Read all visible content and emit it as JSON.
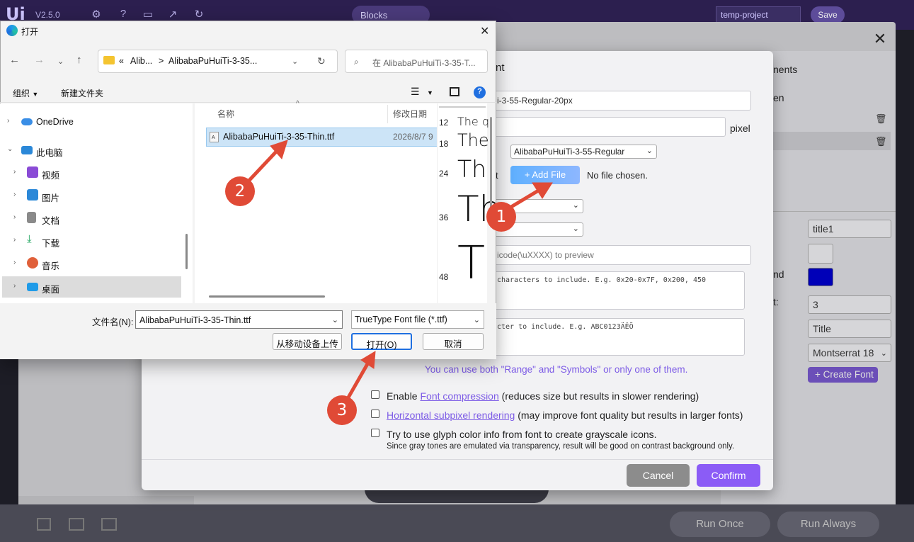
{
  "app": {
    "logo": "Ui",
    "version": "V2.5.0",
    "blocks_tab": "Blocks",
    "project_name": "temp-project",
    "save_label": "Save",
    "run_once": "Run Once",
    "run_always": "Run Always"
  },
  "right_panel": {
    "components_label": "nents",
    "screen_label": "en",
    "name_value": "title1",
    "and_label": "nd",
    "t_label": "t:",
    "spacing_value": "3",
    "text_value": "Title",
    "font_value": "Montserrat 18",
    "create_font": "Create Font"
  },
  "font_dialog": {
    "title_suffix": "nt",
    "name_value": "i-3-55-Regular-20px",
    "size_unit": "pixel",
    "font_select": "AlibabaPuHuiTi-3-55-Regular",
    "font_label_suffix": "t",
    "add_file": "Add File",
    "no_file": "No file chosen.",
    "preview_placeholder": "icode(\\uXXXX) to preview",
    "range_placeholder": "characters to include. E.g. 0x20-0x7F, 0x200, 450",
    "symbols_placeholder": "cter to include. E.g. ABC0123ÄÊÕ",
    "hint": "You can use both \"Range\" and \"Symbols\" or only one of them.",
    "opt1_prefix": "Enable ",
    "opt1_link": "Font compression",
    "opt1_suffix": " (reduces size but results in slower rendering)",
    "opt2_link": "Horizontal subpixel rendering",
    "opt2_suffix": " (may improve font quality but results in larger fonts)",
    "opt3_text": "Try to use glyph color info from font to create grayscale icons.",
    "opt3_sub": "Since gray tones are emulated via transparency, result will be good on contrast background only.",
    "cancel": "Cancel",
    "confirm": "Confirm"
  },
  "open_dialog": {
    "title": "打开",
    "address": {
      "prefix": "«",
      "crumb1": "Alib...",
      "sep": ">",
      "crumb2": "AlibabaPuHuiTi-3-35..."
    },
    "search_placeholder": "在 AlibabaPuHuiTi-3-35-T...",
    "commands": {
      "organize": "组织",
      "new_folder": "新建文件夹"
    },
    "nav": [
      {
        "label": "OneDrive",
        "icon": "cloud-icon"
      },
      {
        "label": "此电脑",
        "icon": "computer-icon"
      },
      {
        "label": "视频",
        "icon": "video-icon"
      },
      {
        "label": "图片",
        "icon": "picture-icon"
      },
      {
        "label": "文档",
        "icon": "document-icon"
      },
      {
        "label": "下载",
        "icon": "download-icon"
      },
      {
        "label": "音乐",
        "icon": "music-icon"
      },
      {
        "label": "桌面",
        "icon": "desktop-icon"
      }
    ],
    "columns": {
      "name": "名称",
      "date": "修改日期"
    },
    "files": [
      {
        "name": "AlibabaPuHuiTi-3-35-Thin.ttf",
        "date": "2026/8/7 9"
      }
    ],
    "preview": {
      "sizes": [
        "12",
        "18",
        "24",
        "36",
        "48"
      ],
      "samples": [
        "The q",
        "The",
        "Th",
        "Th",
        "T"
      ]
    },
    "filename_label": "文件名(N):",
    "filename_value": "AlibabaPuHuiTi-3-35-Thin.ttf",
    "filetype_value": "TrueType Font file (*.ttf)",
    "upload_mobile": "从移动设备上传",
    "open_btn": "打开(O)",
    "cancel_btn": "取消"
  },
  "annotations": [
    "1",
    "2",
    "3"
  ],
  "colors": {
    "accent": "#8b5cf6",
    "annotation": "#e04a36",
    "selection": "#cce4f7"
  }
}
